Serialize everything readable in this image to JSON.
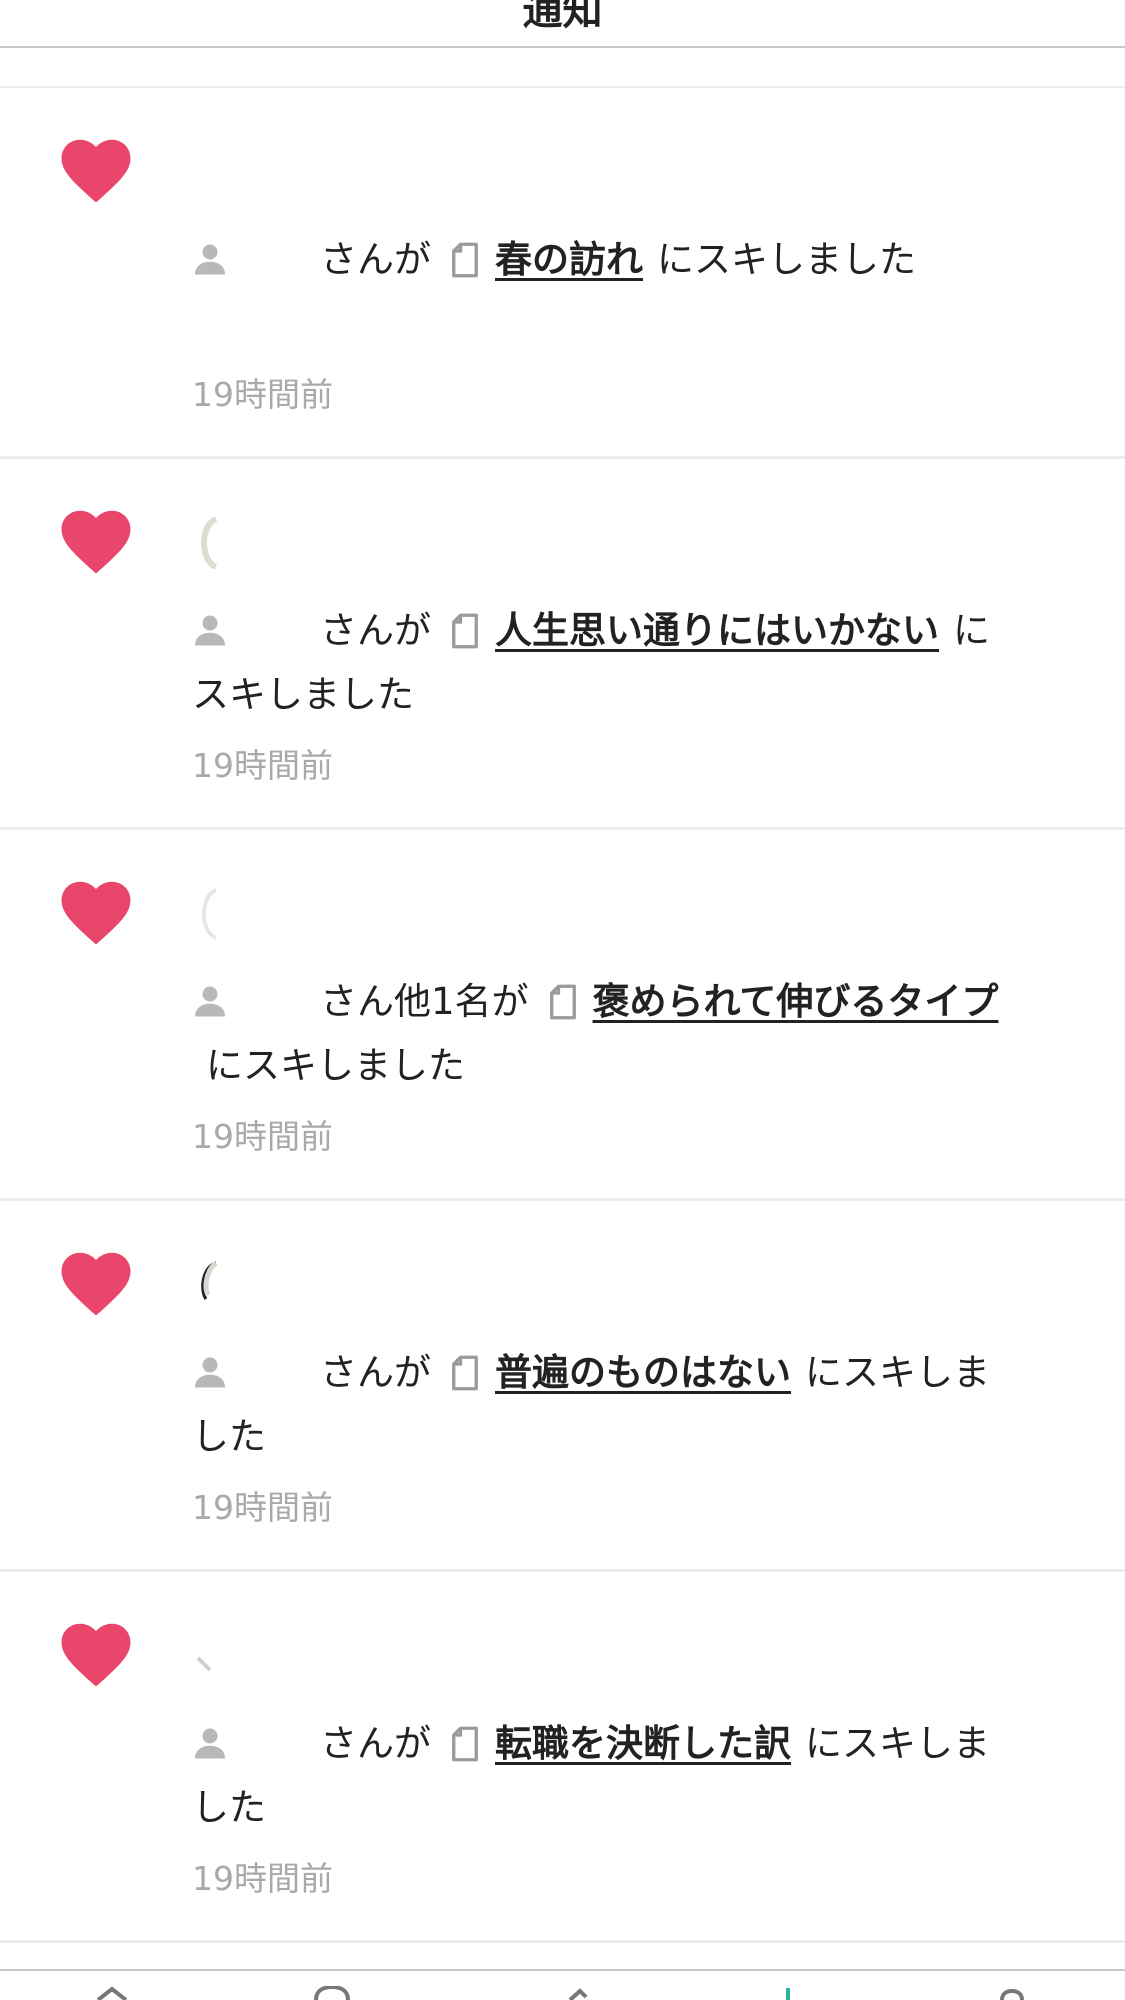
{
  "header": {
    "title": "通知"
  },
  "notifications": [
    {
      "verb": "さんが",
      "article_title": "春の訪れ",
      "suffix": "にスキしました",
      "time": "19時間前"
    },
    {
      "verb": "さんが",
      "article_title": "人生思い通りにはいかない",
      "suffix": "にスキしました",
      "time": "19時間前"
    },
    {
      "verb": "さん他1名が",
      "article_title": "褒められて伸びるタイプ",
      "suffix": "にスキしました",
      "time": "19時間前"
    },
    {
      "verb": "さんが",
      "article_title": "普遍のものはない",
      "suffix": "にスキしました",
      "time": "19時間前"
    },
    {
      "verb": "さんが",
      "article_title": "転職を決断した訳",
      "suffix": "にスキしました",
      "time": "19時間前"
    }
  ],
  "colors": {
    "heart": "#e8476b",
    "time_text": "#a9a9a9",
    "accent_tab": "#2bb5a0"
  },
  "icons": {
    "like": "heart-icon",
    "user": "user-icon",
    "article": "document-icon"
  }
}
